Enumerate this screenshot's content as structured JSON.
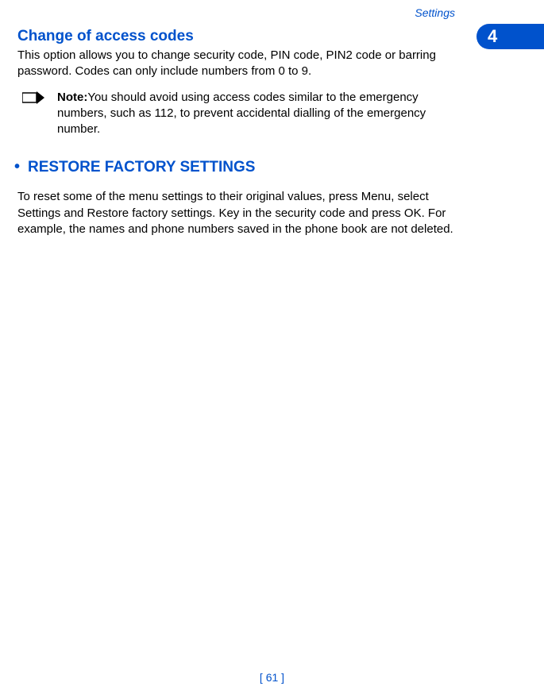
{
  "header": {
    "section_label": "Settings",
    "chapter_number": "4"
  },
  "content": {
    "section1_title": "Change of access codes",
    "section1_body": "This option allows you to change security code, PIN code, PIN2 code or barring password. Codes can only include numbers from 0 to 9.",
    "note_label": "Note:",
    "note_body": "You should avoid using access codes similar to the emergency numbers, such as 112, to prevent accidental dialling of the emergency number.",
    "heading2_bullet": "•",
    "heading2": "RESTORE FACTORY SETTINGS",
    "body2": "To reset some of the menu settings to their original values, press Menu, select Settings and Restore factory settings. Key in the security code and press OK. For example, the names and phone numbers saved in the phone book are not deleted."
  },
  "footer": {
    "page_number": "[ 61 ]"
  }
}
